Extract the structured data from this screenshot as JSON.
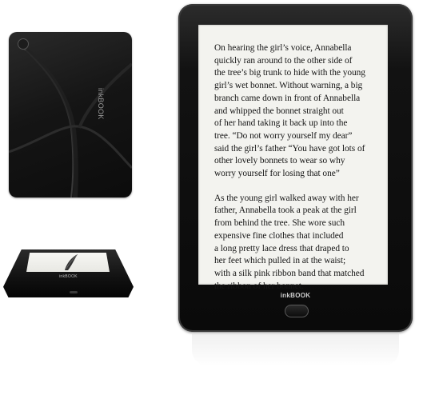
{
  "back_view": {
    "logo": "inkBOOK",
    "power_icon": "power-icon"
  },
  "bottom_view": {
    "logo": "inkBOOK",
    "port_icon": "usb-port-icon"
  },
  "front_view": {
    "screen_paragraphs": [
      [
        "On hearing the girl’s voice, Annabella",
        "quickly ran around to the other side of",
        "the tree’s big trunk to hide with the young",
        "girl’s wet bonnet. Without warning, a big",
        "branch came down in front of Annabella",
        "and whipped the bonnet straight out",
        "of her hand taking it back up into the",
        "tree. “Do not worry yourself my dear”",
        "said the girl’s father “You have got lots of",
        "other lovely bonnets to wear so why",
        "worry yourself for losing that one”"
      ],
      [
        "As the young girl walked away with her",
        "father, Annabella took a peak at the girl",
        "from behind the tree. She wore such",
        "expensive fine clothes that included",
        "a long pretty lace dress that draped to",
        "her feet which pulled in at the waist;",
        "with a silk pink ribbon band that matched",
        "the ribbon of her bonnet."
      ]
    ],
    "logo": "inkBOOK",
    "home_button_icon": "home-button-icon"
  }
}
